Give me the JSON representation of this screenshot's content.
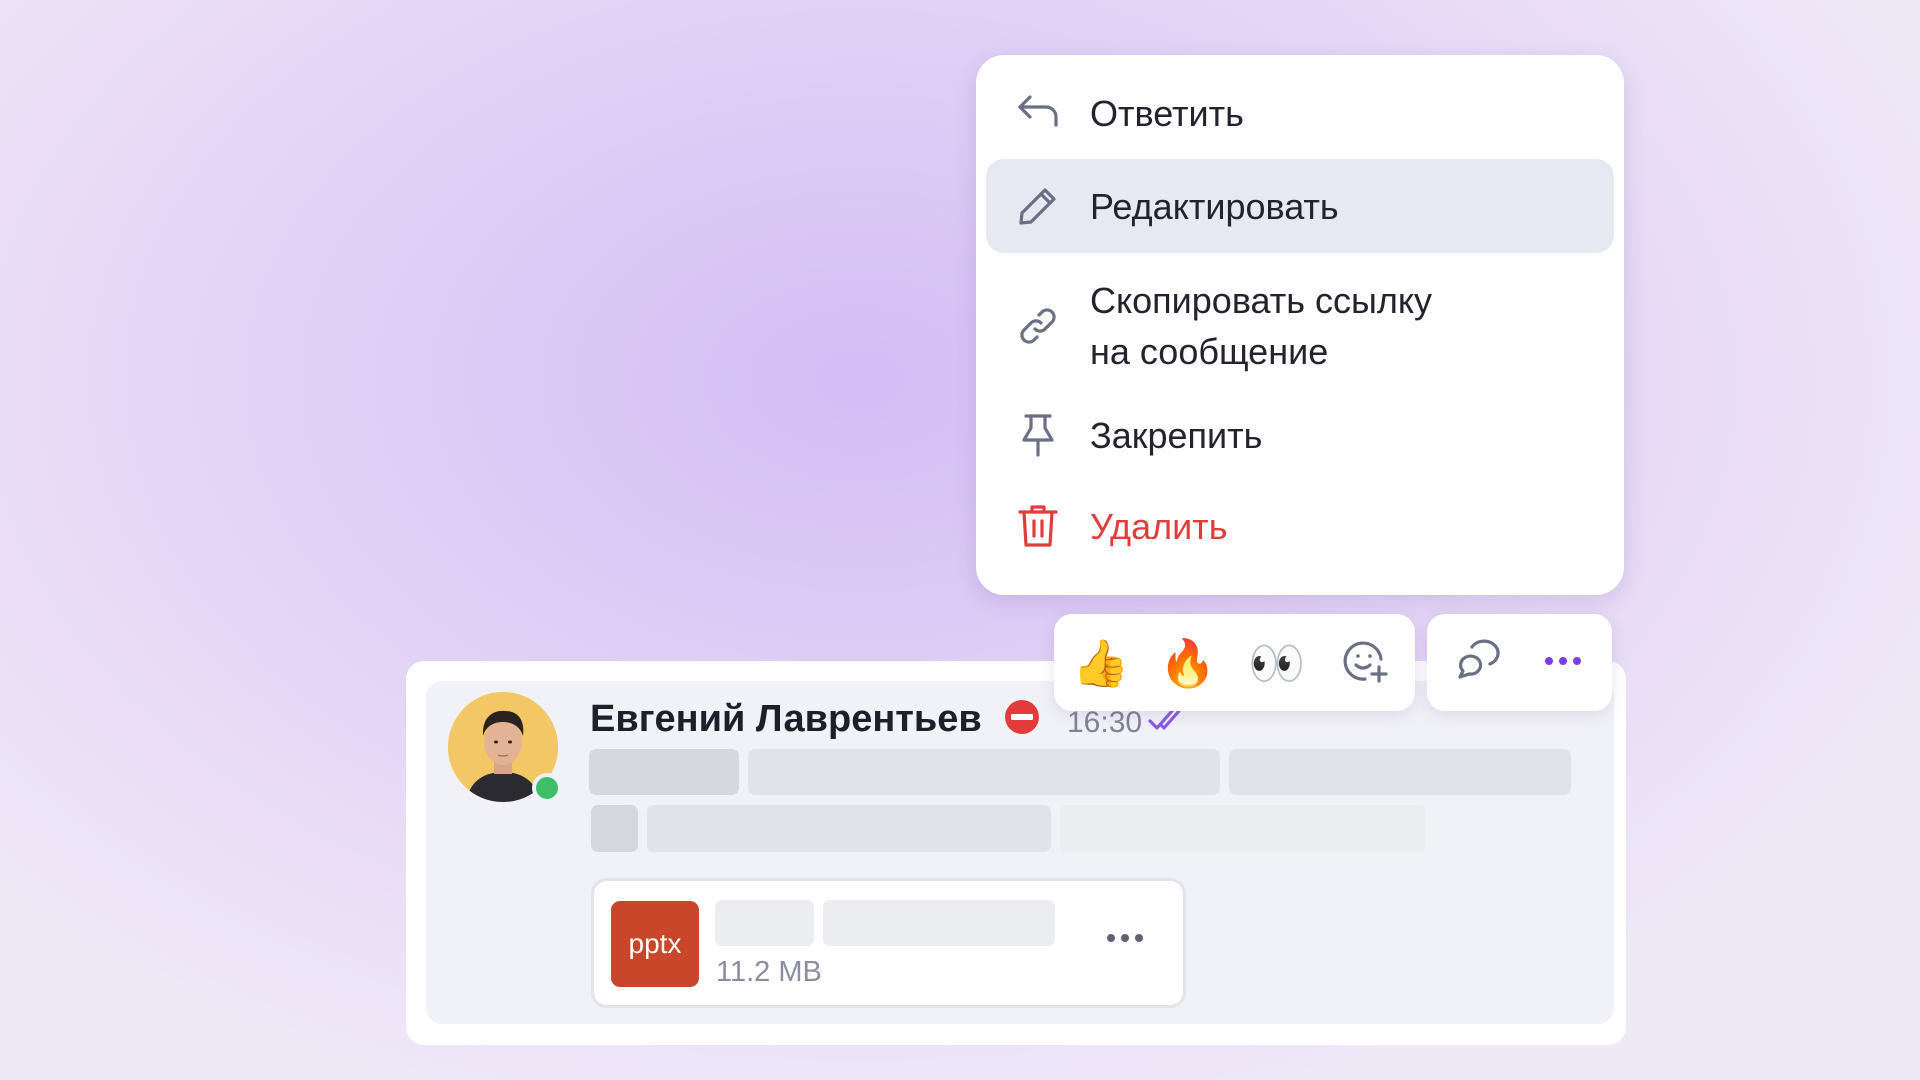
{
  "menu": {
    "items": [
      {
        "label": "Ответить",
        "icon": "reply-icon"
      },
      {
        "label": "Редактировать",
        "icon": "pencil-icon"
      },
      {
        "label": "Скопировать ссылку\nна сообщение",
        "icon": "link-icon"
      },
      {
        "label": "Закрепить",
        "icon": "pin-icon"
      },
      {
        "label": "Удалить",
        "icon": "trash-icon"
      }
    ]
  },
  "reactions": [
    {
      "emoji": "👍",
      "name": "thumbs-up"
    },
    {
      "emoji": "🔥",
      "name": "fire"
    },
    {
      "emoji": "👀",
      "name": "eyes"
    }
  ],
  "message": {
    "author": "Евгений Лаврентьев",
    "time": "16:30",
    "attachment": {
      "type": "pptx",
      "size": "11.2 MB"
    }
  },
  "colors": {
    "accent": "#7b3fe4",
    "danger": "#e23b3b",
    "online": "#3fbf6a",
    "file_badge": "#c9462a"
  }
}
